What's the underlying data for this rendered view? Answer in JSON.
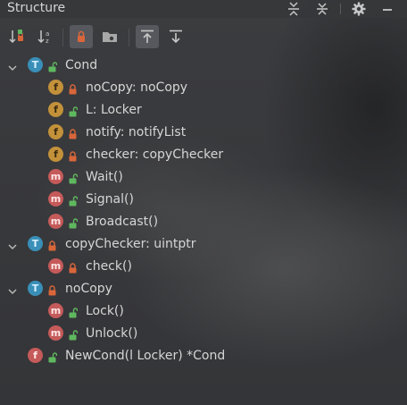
{
  "panel": {
    "title": "Structure"
  },
  "title_actions": [
    {
      "name": "expand-all-icon"
    },
    {
      "name": "collapse-all-icon"
    },
    {
      "name": "gear-icon"
    },
    {
      "name": "minimize-icon"
    }
  ],
  "toolbar": {
    "buttons": [
      {
        "name": "sort-by-visibility-icon",
        "active": false
      },
      {
        "name": "sort-alphabetically-icon",
        "active": false
      },
      {
        "name": "show-non-public-icon",
        "active": true
      },
      {
        "name": "show-fields-folder-icon",
        "active": false
      },
      {
        "name": "autoscroll-to-source-icon",
        "active": true
      },
      {
        "name": "autoscroll-from-source-icon",
        "active": false
      }
    ]
  },
  "tree": [
    {
      "level": 0,
      "expanded": true,
      "kind": "T",
      "visibility": "public",
      "label": "Cond"
    },
    {
      "level": 1,
      "kind": "f",
      "visibility": "private",
      "label": "noCopy: noCopy"
    },
    {
      "level": 1,
      "kind": "f",
      "visibility": "public",
      "label": "L: Locker"
    },
    {
      "level": 1,
      "kind": "f",
      "visibility": "private",
      "label": "notify: notifyList"
    },
    {
      "level": 1,
      "kind": "f",
      "visibility": "private",
      "label": "checker: copyChecker"
    },
    {
      "level": 1,
      "kind": "m",
      "visibility": "public",
      "label": "Wait()"
    },
    {
      "level": 1,
      "kind": "m",
      "visibility": "public",
      "label": "Signal()"
    },
    {
      "level": 1,
      "kind": "m",
      "visibility": "public",
      "label": "Broadcast()"
    },
    {
      "level": 0,
      "expanded": true,
      "kind": "T",
      "visibility": "private",
      "label": "copyChecker: uintptr"
    },
    {
      "level": 1,
      "kind": "m",
      "visibility": "private",
      "label": "check()"
    },
    {
      "level": 0,
      "expanded": true,
      "kind": "T",
      "visibility": "private",
      "label": "noCopy"
    },
    {
      "level": 1,
      "kind": "m",
      "visibility": "public",
      "label": "Lock()"
    },
    {
      "level": 1,
      "kind": "m",
      "visibility": "public",
      "label": "Unlock()"
    },
    {
      "level": 0,
      "expanded": false,
      "leaf": true,
      "kind": "f",
      "visibility": "public",
      "label": "NewCond(l Locker) *Cond"
    }
  ],
  "colors": {
    "type_badge": "#3a8fb8",
    "field_badge": "#c2913a",
    "method_badge": "#c55a5a",
    "lock_public": "#5fb85f",
    "lock_private": "#d9663a"
  }
}
